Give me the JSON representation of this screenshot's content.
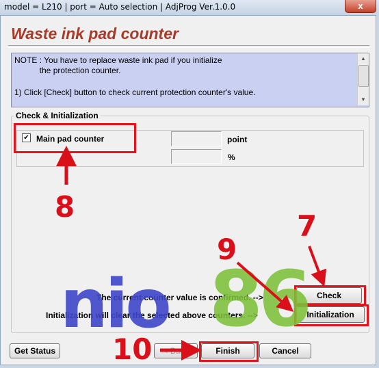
{
  "window": {
    "title": "model = L210 | port = Auto selection | AdjProg Ver.1.0.0",
    "close_glyph": "x"
  },
  "heading": "Waste ink pad counter",
  "note": {
    "line1": "NOTE : You have to replace waste ink pad if you initialize",
    "line2": "           the protection counter.",
    "line3": "1) Click [Check] button to check current protection counter's value."
  },
  "group": {
    "label": "Check & Initialization",
    "checkbox_label": "Main pad counter",
    "checkbox_checked": true,
    "point_value": "",
    "point_unit": "point",
    "percent_value": "",
    "percent_unit": "%"
  },
  "messages": {
    "confirmed": "The current counter value is confirmed.  -->",
    "initialization": "Initialization will clear the selected above counters.  -->"
  },
  "buttons": {
    "check": "Check",
    "initialization": "Initialization",
    "get_status": "Get Status",
    "back": "< Back",
    "finish": "Finish",
    "cancel": "Cancel"
  },
  "annotations": {
    "step7": "7",
    "step8": "8",
    "step9": "9",
    "step10": "10"
  },
  "watermark": {
    "part1": "nio",
    "part2": "86"
  },
  "colors": {
    "highlight_red": "#e3141e",
    "heading": "#a83a2a",
    "note_bg": "#c9d0f2",
    "watermark_blue": "#3f46c8",
    "watermark_green": "#7ec23a"
  }
}
